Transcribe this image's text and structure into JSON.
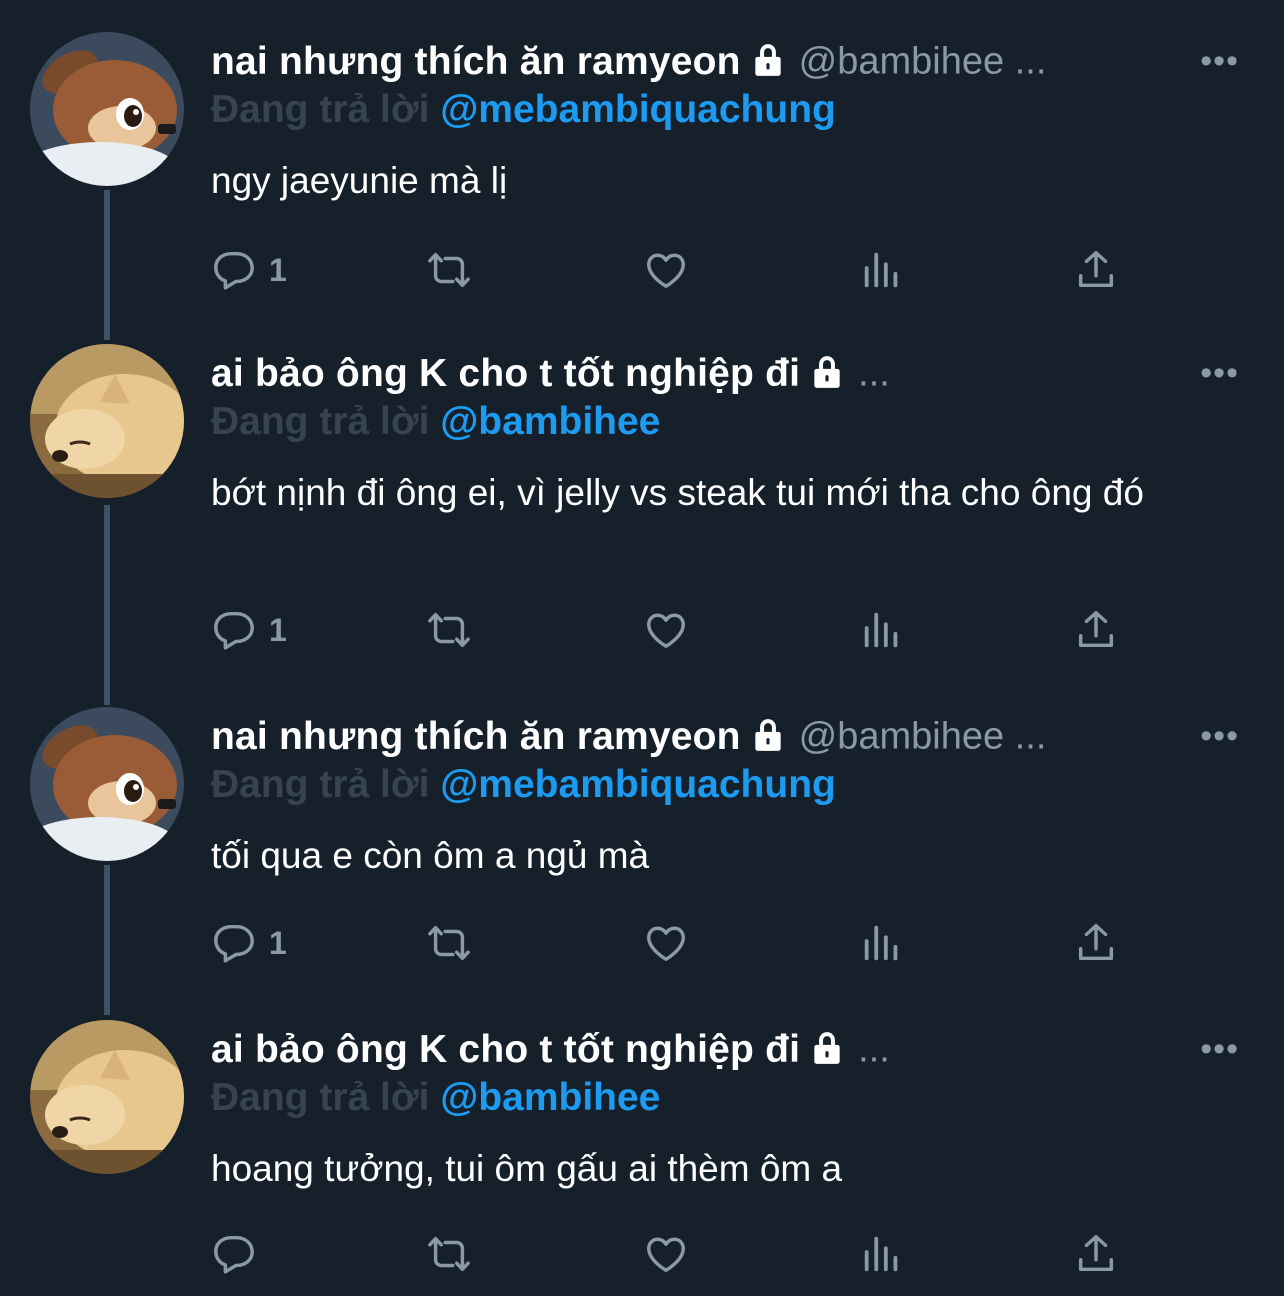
{
  "colors": {
    "background": "#15202b",
    "accent": "#1d9bf0",
    "muted": "#8b98a5"
  },
  "tweets": [
    {
      "name": "nai nhưng thích ăn ramyeon",
      "handle": "@bambihee ...",
      "more": "•••",
      "replying_label": "Đang trả lời",
      "replying_to": "@mebambiquachung",
      "text": "ngy jaeyunie mà lị",
      "reply_count": "1",
      "avatar": "bambi-avatar"
    },
    {
      "name": "ai bảo ông K cho t tốt nghiệp đi",
      "handle": "...",
      "more": "•••",
      "replying_label": "Đang trả lời",
      "replying_to": "@bambihee",
      "text": "bớt nịnh đi ông ei, vì jelly vs steak tui mới tha cho ông đó",
      "reply_count": "1",
      "avatar": "dog-avatar"
    },
    {
      "name": "nai nhưng thích ăn ramyeon",
      "handle": "@bambihee ...",
      "more": "•••",
      "replying_label": "Đang trả lời",
      "replying_to": "@mebambiquachung",
      "text": "tối qua e còn ôm a ngủ mà",
      "reply_count": "1",
      "avatar": "bambi-avatar"
    },
    {
      "name": "ai bảo ông K cho t tốt nghiệp đi",
      "handle": "...",
      "more": "•••",
      "replying_label": "Đang trả lời",
      "replying_to": "@bambihee",
      "text": "hoang tưởng, tui ôm gấu ai thèm ôm a",
      "reply_count": "",
      "avatar": "dog-avatar"
    }
  ]
}
